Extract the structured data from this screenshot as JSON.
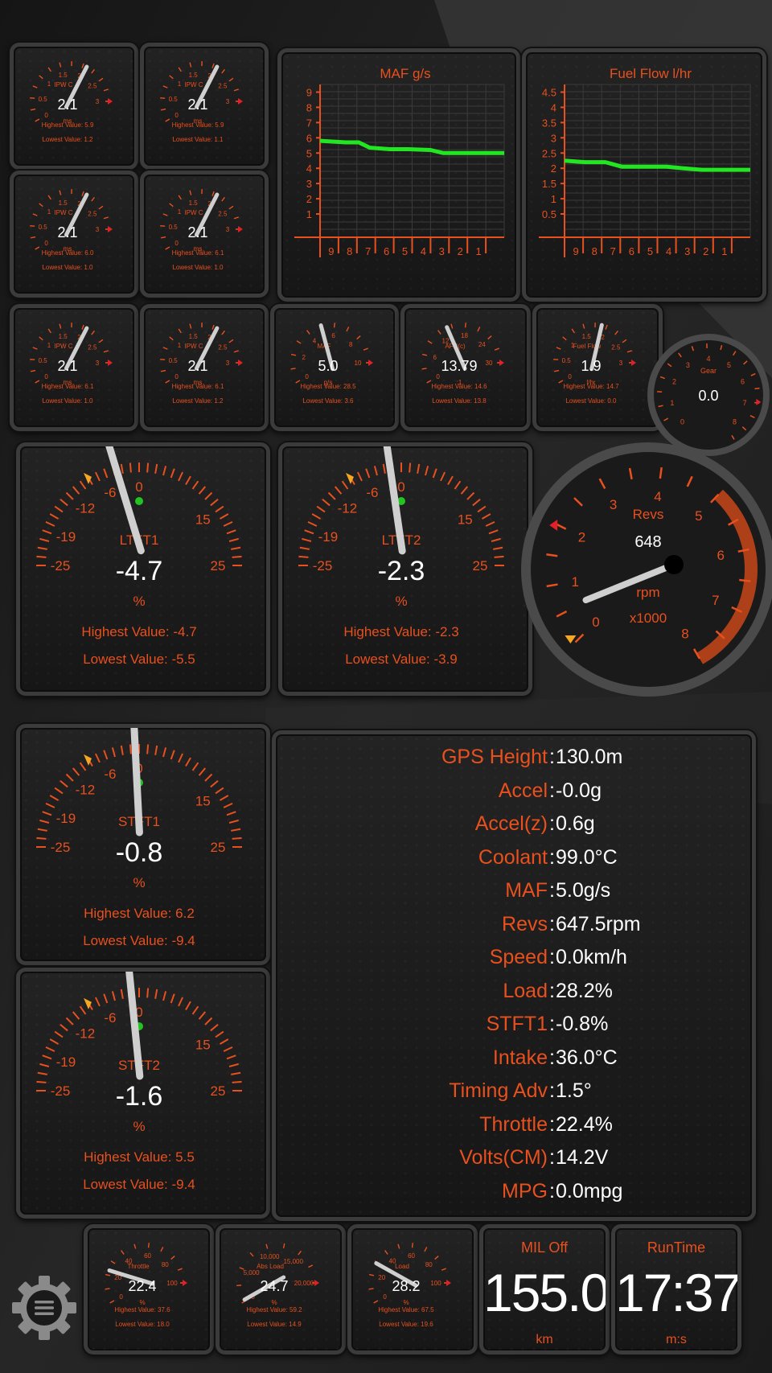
{
  "colors": {
    "accent": "#e8501e",
    "needle": "#cfcfcf",
    "trace": "#22e622",
    "marker": "#f5a623",
    "red_marker": "#e3202a",
    "bezel": "#3b3b3b"
  },
  "small_gauges": [
    {
      "title": "IPW C",
      "value": "2.1",
      "unit": "ms",
      "highest": "Highest Value: 5.9",
      "lowest": "Lowest Value: 1.2",
      "ticks": [
        "0",
        "0.5",
        "1",
        "1.5",
        "2",
        "2.5",
        "3"
      ],
      "min": 0,
      "max": 3,
      "reading": 2.1
    },
    {
      "title": "IPW C",
      "value": "2.1",
      "unit": "ms",
      "highest": "Highest Value: 5.9",
      "lowest": "Lowest Value: 1.1",
      "ticks": [
        "0",
        "0.5",
        "1",
        "1.5",
        "2",
        "2.5",
        "3"
      ],
      "min": 0,
      "max": 3,
      "reading": 2.1
    },
    {
      "title": "IPW C",
      "value": "2.1",
      "unit": "ms",
      "highest": "Highest Value: 6.0",
      "lowest": "Lowest Value: 1.0",
      "ticks": [
        "0",
        "0.5",
        "1",
        "1.5",
        "2",
        "2.5",
        "3"
      ],
      "min": 0,
      "max": 3,
      "reading": 2.1
    },
    {
      "title": "IPW C",
      "value": "2.1",
      "unit": "ms",
      "highest": "Highest Value: 6.1",
      "lowest": "Lowest Value: 1.0",
      "ticks": [
        "0",
        "0.5",
        "1",
        "1.5",
        "2",
        "2.5",
        "3"
      ],
      "min": 0,
      "max": 3,
      "reading": 2.1
    },
    {
      "title": "IPW C",
      "value": "2.1",
      "unit": "ms",
      "highest": "Highest Value: 6.1",
      "lowest": "Lowest Value: 1.0",
      "ticks": [
        "0",
        "0.5",
        "1",
        "1.5",
        "2",
        "2.5",
        "3"
      ],
      "min": 0,
      "max": 3,
      "reading": 2.1
    },
    {
      "title": "IPW C",
      "value": "2.1",
      "unit": "ms",
      "highest": "Highest Value: 6.1",
      "lowest": "Lowest Value: 1.2",
      "ticks": [
        "0",
        "0.5",
        "1",
        "1.5",
        "2",
        "2.5",
        "3"
      ],
      "min": 0,
      "max": 3,
      "reading": 2.1
    },
    {
      "title": "MAF",
      "value": "5.0",
      "unit": "g/s",
      "highest": "Highest Value: 28.5",
      "lowest": "Lowest Value: 3.6",
      "ticks": [
        "0",
        "2",
        "4",
        "6",
        "8",
        "10"
      ],
      "min": 0,
      "max": 10,
      "reading": 5.0
    },
    {
      "title": "AFR(c)",
      "value": "13.79",
      "unit": ":1",
      "highest": "Highest Value: 14.6",
      "lowest": "Lowest Value: 13.8",
      "ticks": [
        "0",
        "6",
        "12",
        "18",
        "24",
        "30"
      ],
      "min": 0,
      "max": 30,
      "reading": 13.79
    },
    {
      "title": "Fuel Flow",
      "value": "1.9",
      "unit": "l/hr",
      "highest": "Highest Value: 14.7",
      "lowest": "Lowest Value: 0.0",
      "ticks": [
        "0",
        "0.5",
        "1",
        "1.5",
        "2",
        "2.5",
        "3"
      ],
      "min": 0,
      "max": 3,
      "reading": 1.9
    }
  ],
  "gear": {
    "title": "Gear",
    "value": "0.0",
    "ticks": [
      "0",
      "1",
      "2",
      "3",
      "4",
      "5",
      "6",
      "7",
      "8"
    ]
  },
  "charts": [
    {
      "title": "MAF  g/s",
      "chart_data": {
        "type": "line",
        "x": [
          9,
          8,
          7,
          6,
          5,
          4,
          3,
          2,
          1
        ],
        "y_ticks": [
          "1",
          "2",
          "3",
          "4",
          "5",
          "6",
          "7",
          "8",
          "9"
        ],
        "ylim": [
          0,
          9.5
        ],
        "xlim": [
          10,
          0
        ],
        "series": [
          {
            "values": [
              [
                10,
                5.8
              ],
              [
                8.6,
                5.7
              ],
              [
                7.9,
                5.7
              ],
              [
                7.3,
                5.35
              ],
              [
                6.2,
                5.25
              ],
              [
                5.2,
                5.25
              ],
              [
                4.0,
                5.2
              ],
              [
                3.3,
                5.0
              ],
              [
                2.2,
                5.0
              ],
              [
                1.2,
                5.0
              ],
              [
                0,
                5.0
              ]
            ]
          }
        ]
      }
    },
    {
      "title": "Fuel Flow  l/hr",
      "chart_data": {
        "type": "line",
        "x": [
          9,
          8,
          7,
          6,
          5,
          4,
          3,
          2,
          1
        ],
        "y_ticks": [
          "0.5",
          "1",
          "1.5",
          "2",
          "2.5",
          "3",
          "3.5",
          "4",
          "4.5"
        ],
        "ylim": [
          0,
          4.75
        ],
        "xlim": [
          10,
          0
        ],
        "series": [
          {
            "values": [
              [
                10,
                2.25
              ],
              [
                8.9,
                2.2
              ],
              [
                7.8,
                2.2
              ],
              [
                6.9,
                2.05
              ],
              [
                5.5,
                2.05
              ],
              [
                4.5,
                2.05
              ],
              [
                3.6,
                2.0
              ],
              [
                2.6,
                1.95
              ],
              [
                1.4,
                1.95
              ],
              [
                0,
                1.95
              ]
            ]
          }
        ]
      }
    }
  ],
  "large_gauges": [
    {
      "title": "LTFT1",
      "value": "-4.7",
      "unit": "%",
      "highest": "Highest Value: -4.7",
      "lowest": "Lowest Value: -5.5",
      "ticks": [
        "-25",
        "-19",
        "-12",
        "-6",
        "0",
        "15",
        "25"
      ],
      "reading": -4.7
    },
    {
      "title": "LTFT2",
      "value": "-2.3",
      "unit": "%",
      "highest": "Highest Value: -2.3",
      "lowest": "Lowest Value: -3.9",
      "ticks": [
        "-25",
        "-19",
        "-12",
        "-6",
        "0",
        "15",
        "25"
      ],
      "reading": -2.3
    },
    {
      "title": "STFT1",
      "value": "-0.8",
      "unit": "%",
      "highest": "Highest Value: 6.2",
      "lowest": "Lowest Value: -9.4",
      "ticks": [
        "-25",
        "-19",
        "-12",
        "-6",
        "0",
        "15",
        "25"
      ],
      "reading": -0.8
    },
    {
      "title": "STFT2",
      "value": "-1.6",
      "unit": "%",
      "highest": "Highest Value: 5.5",
      "lowest": "Lowest Value: -9.4",
      "ticks": [
        "-25",
        "-19",
        "-12",
        "-6",
        "0",
        "15",
        "25"
      ],
      "reading": -1.6
    }
  ],
  "revs": {
    "title": "Revs",
    "value": "648",
    "unit": "rpm",
    "multiplier": "x1000",
    "ticks": [
      "0",
      "1",
      "2",
      "3",
      "4",
      "5",
      "6",
      "7",
      "8"
    ],
    "reading": 0.648
  },
  "info": [
    {
      "label": "GPS Height",
      "value": "130.0m"
    },
    {
      "label": "Accel",
      "value": "-0.0g"
    },
    {
      "label": "Accel(z)",
      "value": "0.6g"
    },
    {
      "label": "Coolant",
      "value": "99.0°C"
    },
    {
      "label": "MAF",
      "value": "5.0g/s"
    },
    {
      "label": "Revs",
      "value": "647.5rpm"
    },
    {
      "label": "Speed",
      "value": "0.0km/h"
    },
    {
      "label": "Load",
      "value": "28.2%"
    },
    {
      "label": "STFT1",
      "value": "-0.8%"
    },
    {
      "label": "Intake",
      "value": "36.0°C"
    },
    {
      "label": "Timing Adv",
      "value": "1.5°"
    },
    {
      "label": "Throttle",
      "value": "22.4%"
    },
    {
      "label": "Volts(CM)",
      "value": "14.2V"
    },
    {
      "label": "MPG",
      "value": "0.0mpg"
    }
  ],
  "bottom_gauges": [
    {
      "title": "Throttle",
      "value": "22.4",
      "unit": "%",
      "highest": "Highest Value: 37.6",
      "lowest": "Lowest Value: 18.0",
      "ticks": [
        "0",
        "20",
        "40",
        "60",
        "80",
        "100"
      ],
      "min": 0,
      "max": 100,
      "reading": 22.4
    },
    {
      "title": "Abs Load",
      "value": "24.7",
      "unit": "%",
      "highest": "Highest Value: 59.2",
      "lowest": "Lowest Value: 14.9",
      "ticks": [
        "0",
        "5,000",
        "10,000",
        "15,000",
        "20,000"
      ],
      "min": 0,
      "max": 20000,
      "reading": 24.7
    },
    {
      "title": "Load",
      "value": "28.2",
      "unit": "%",
      "highest": "Highest Value: 67.5",
      "lowest": "Lowest Value: 19.6",
      "ticks": [
        "0",
        "20",
        "40",
        "60",
        "80",
        "100"
      ],
      "min": 0,
      "max": 100,
      "reading": 28.2
    }
  ],
  "digital": [
    {
      "label": "MIL Off",
      "value": "155.0",
      "unit": "km"
    },
    {
      "label": "RunTime",
      "value": "17:37",
      "unit": "m:s"
    }
  ]
}
